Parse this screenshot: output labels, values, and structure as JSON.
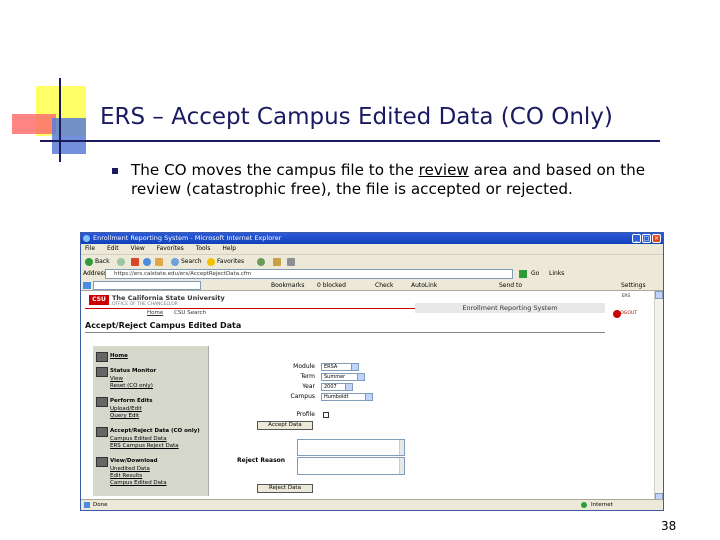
{
  "slide": {
    "title": "ERS – Accept Campus Edited Data (CO Only)",
    "bullet_before": "The CO moves the campus file to the ",
    "bullet_link": "review",
    "bullet_after": " area and based on the review (catastrophic free), the file is accepted or rejected.",
    "page_number": "38"
  },
  "browser": {
    "window_title": "Enrollment Reporting System - Microsoft Internet Explorer",
    "menu": [
      "File",
      "Edit",
      "View",
      "Favorites",
      "Tools",
      "Help"
    ],
    "toolbar": {
      "back": "Back",
      "search": "Search",
      "favorites": "Favorites"
    },
    "address_label": "Address",
    "address_value": "https://ers.calstate.edu/ers/AcceptRejectData.cfm",
    "go_label": "Go",
    "links_label": "Links",
    "links_bar": [
      "Bookmarks",
      "0 blocked",
      "Check",
      "AutoLink",
      "Send to",
      "Settings"
    ],
    "status_left": "Done",
    "status_right": "Internet"
  },
  "site": {
    "logo": "CSU",
    "university_name": "The California State University",
    "university_sub": "OFFICE OF THE CHANCELLOR",
    "nav_home": "Home",
    "nav_search": "CSU Search",
    "app_name": "Enrollment Reporting System",
    "page_heading": "Accept/Reject Campus Edited Data",
    "badge_top": "ERS",
    "badge_bottom": "LOGOUT"
  },
  "sidebar": {
    "sections": [
      {
        "title": "Home",
        "links": []
      },
      {
        "title": "Status Monitor",
        "links": [
          "View",
          "Reset (CO only)"
        ]
      },
      {
        "title": "Perform Edits",
        "links": [
          "Upload/Edit",
          "Query Edit"
        ]
      },
      {
        "title": "Accept/Reject Data (CO only)",
        "links": [
          "Campus Edited Data",
          "ERS Campus Reject Data"
        ]
      },
      {
        "title": "View/Download",
        "links": [
          "Unedited Data",
          "Edit Results",
          "Campus Edited Data"
        ]
      }
    ]
  },
  "form": {
    "module_label": "Module",
    "module_value": "ERSA",
    "term_label": "Term",
    "term_value": "Summer",
    "year_label": "Year",
    "year_value": "2007",
    "campus_label": "Campus",
    "campus_value": "Humboldt",
    "profile_label": "Profile",
    "accept_button": "Accept Data",
    "reject_reason_label": "Reject Reason",
    "reject_button": "Reject Data"
  }
}
